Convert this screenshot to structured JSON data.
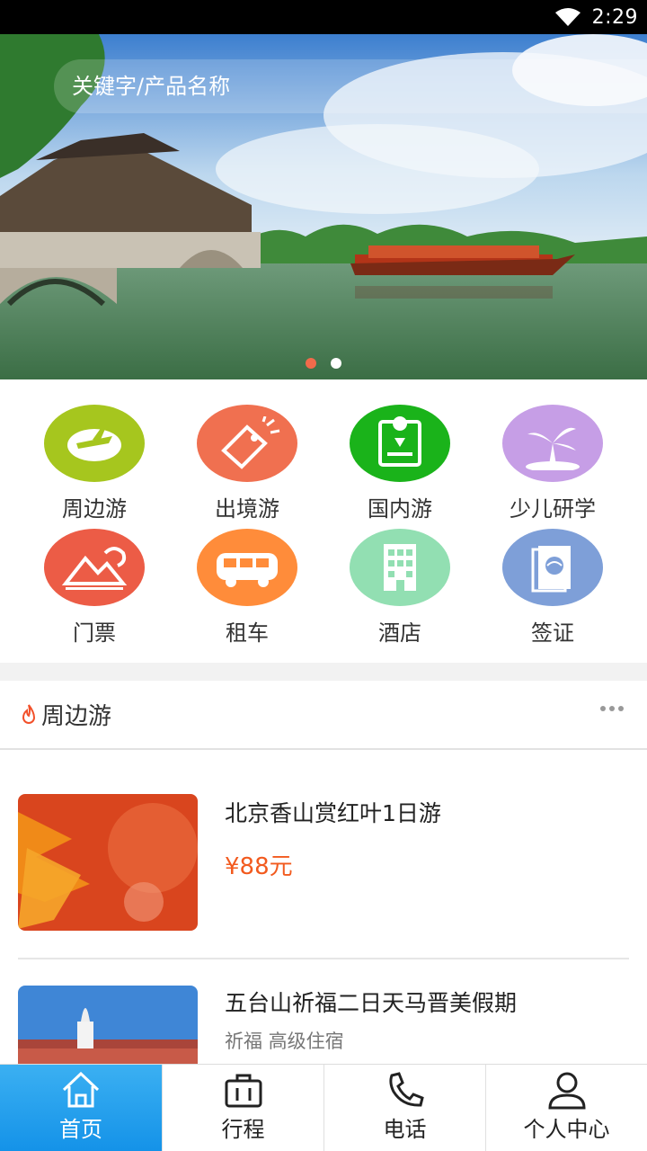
{
  "status_bar": {
    "time": "2:29"
  },
  "search": {
    "placeholder": "关键字/产品名称"
  },
  "carousel": {
    "total": 2,
    "active_index": 0
  },
  "categories": [
    {
      "label": "周边游",
      "icon": "plane-icon",
      "color": "#a6c61e"
    },
    {
      "label": "出境游",
      "icon": "tag-icon",
      "color": "#f07050"
    },
    {
      "label": "国内游",
      "icon": "map-location-icon",
      "color": "#1ab31a"
    },
    {
      "label": "少儿研学",
      "icon": "palm-island-icon",
      "color": "#c69ee6"
    },
    {
      "label": "门票",
      "icon": "mountain-icon",
      "color": "#ec5c46"
    },
    {
      "label": "租车",
      "icon": "bus-icon",
      "color": "#ff8c3a"
    },
    {
      "label": "酒店",
      "icon": "building-icon",
      "color": "#92dfb2"
    },
    {
      "label": "签证",
      "icon": "passport-icon",
      "color": "#7e9fd8"
    }
  ],
  "section": {
    "title": "周边游",
    "icon": "flame-icon",
    "items": [
      {
        "name": "北京香山赏红叶1日游",
        "price": "¥88元"
      },
      {
        "name": "五台山祈福二日天马晋美假期",
        "tags": "祈福  高级住宿"
      }
    ]
  },
  "tabbar": [
    {
      "label": "首页",
      "icon": "home-icon",
      "active": true
    },
    {
      "label": "行程",
      "icon": "briefcase-icon",
      "active": false
    },
    {
      "label": "电话",
      "icon": "phone-icon",
      "active": false
    },
    {
      "label": "个人中心",
      "icon": "person-icon",
      "active": false
    }
  ],
  "colors": {
    "accent": "#1492e8",
    "price": "#f25a1e",
    "dot_active": "#f26a4b"
  }
}
